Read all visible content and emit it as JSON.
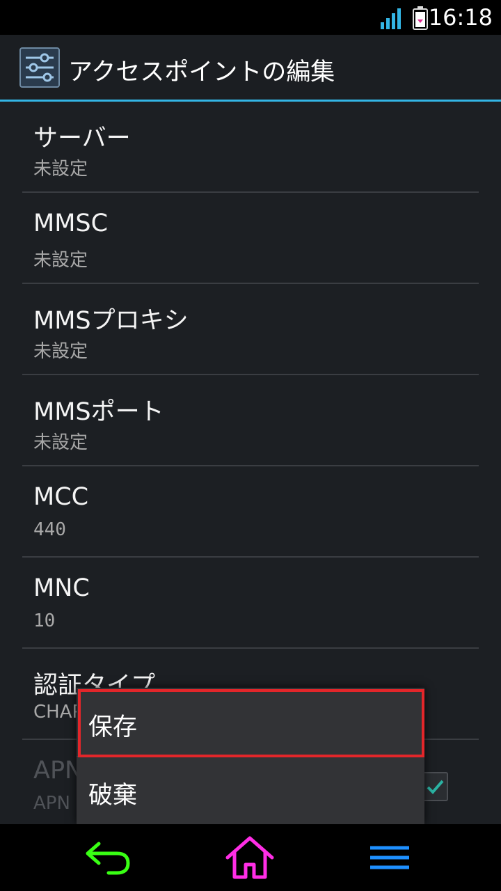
{
  "status_bar": {
    "time": "16:18"
  },
  "action_bar": {
    "title": "アクセスポイントの編集"
  },
  "preferences": [
    {
      "title": "サーバー",
      "summary": "未設定"
    },
    {
      "title": "MMSC",
      "summary": "未設定"
    },
    {
      "title": "MMSプロキシ",
      "summary": "未設定"
    },
    {
      "title": "MMSポート",
      "summary": "未設定"
    },
    {
      "title": "MCC",
      "summary": "440"
    },
    {
      "title": "MNC",
      "summary": "10"
    },
    {
      "title": "認証タイプ",
      "summary": "CHAP"
    },
    {
      "title": "APN",
      "summary": "APN"
    }
  ],
  "menu": {
    "save": "保存",
    "discard": "破棄"
  },
  "colors": {
    "accent": "#33b5e5",
    "highlight": "#e3262a",
    "nav_back": "#39ff14",
    "nav_home": "#ff2ee6",
    "nav_menu": "#1e90ff"
  },
  "icons": [
    "signal-icon",
    "battery-icon",
    "settings-sliders-icon",
    "back-icon",
    "home-icon",
    "menu-icon",
    "checkbox-checked-icon"
  ]
}
